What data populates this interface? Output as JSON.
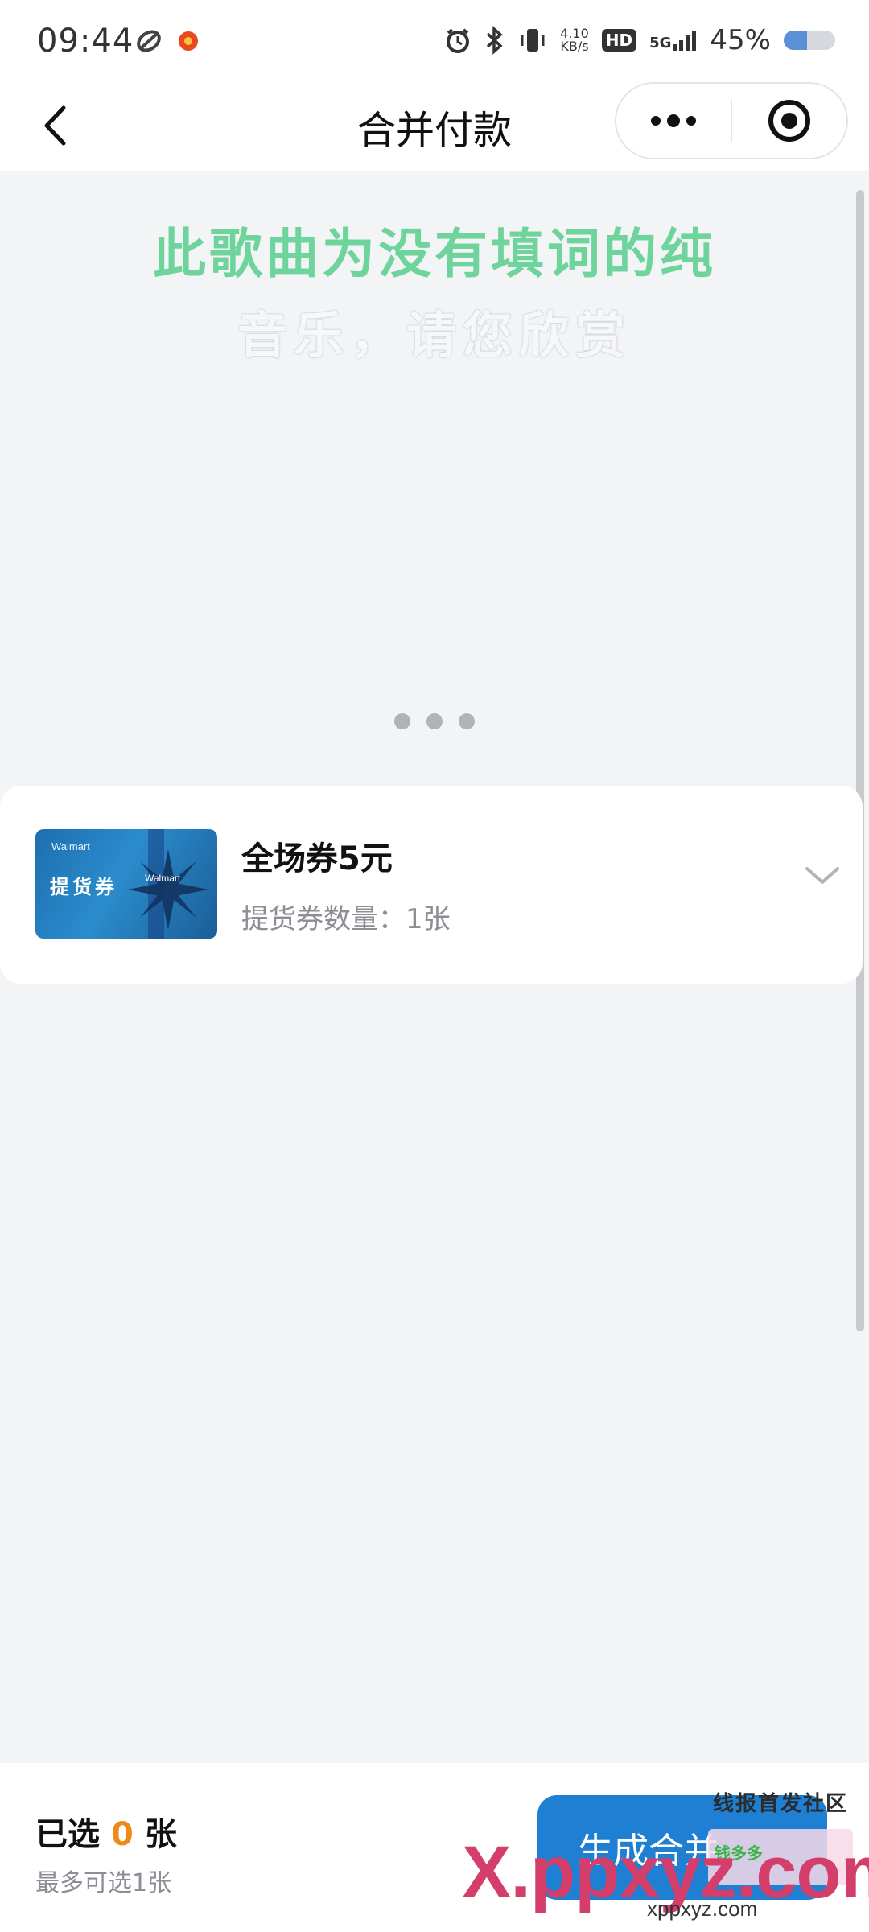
{
  "status_bar": {
    "time": "09:44",
    "net_speed_value": "4.10",
    "net_speed_unit": "KB/s",
    "hd_badge": "HD",
    "network": "5G",
    "battery_text": "45%",
    "battery_level": 0.45,
    "icons": [
      "sync-icon",
      "notification-app-icon",
      "alarm-icon",
      "bluetooth-icon",
      "vibrate-icon",
      "signal-icon",
      "battery-icon"
    ]
  },
  "nav": {
    "title": "合并付款",
    "back_icon": "chevron-left-icon",
    "more_icon": "more-dots-icon",
    "close_icon": "target-close-icon"
  },
  "lyrics": {
    "line1": "此歌曲为没有填词的纯",
    "line2": "音乐，请您欣赏"
  },
  "voucher": {
    "thumb_brand": "Walmart",
    "thumb_label": "提货券",
    "title": "全场券5元",
    "count_text": "提货券数量：1张",
    "accent": "#1f7fd3"
  },
  "bottom": {
    "selected_prefix": "已选",
    "selected_count": "0",
    "selected_suffix": "张",
    "max_text": "最多可选1张",
    "button_label": "生成合并",
    "count_color": "#ef8a19"
  },
  "watermark": {
    "community": "线报首发社区",
    "main": "X.ppxyz.com",
    "sub": "xppxyz.com",
    "badge_text": "钱多多"
  }
}
